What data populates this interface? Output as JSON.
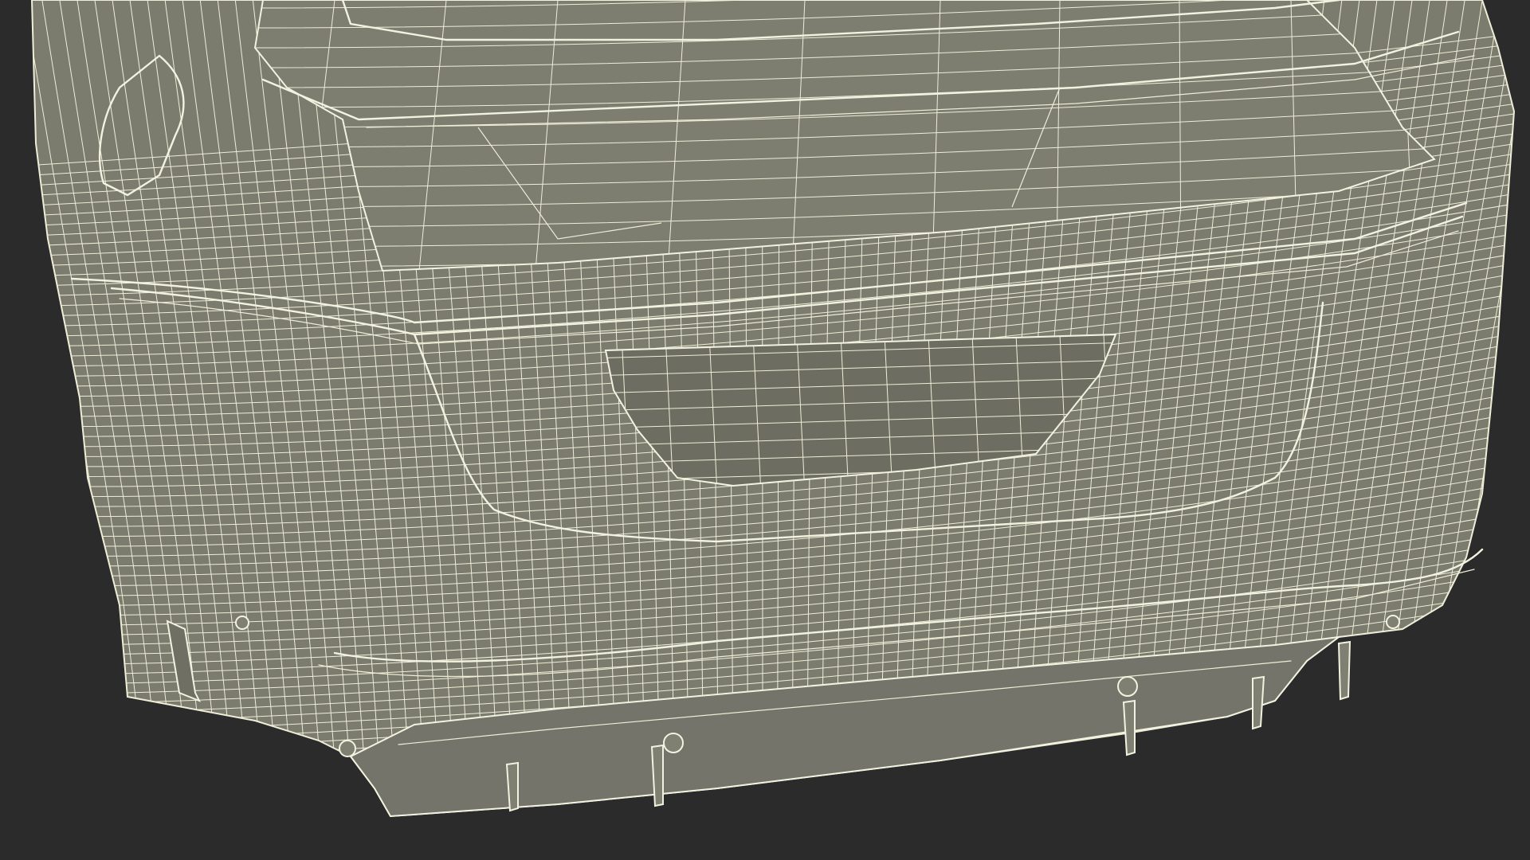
{
  "scene": {
    "subject": "car-rear-wireframe",
    "background_color": "#2b2b2b",
    "surface_color": "#7b7b6e",
    "surface_dark_color": "#6d6d61",
    "wire_color": "#eeeed8"
  }
}
